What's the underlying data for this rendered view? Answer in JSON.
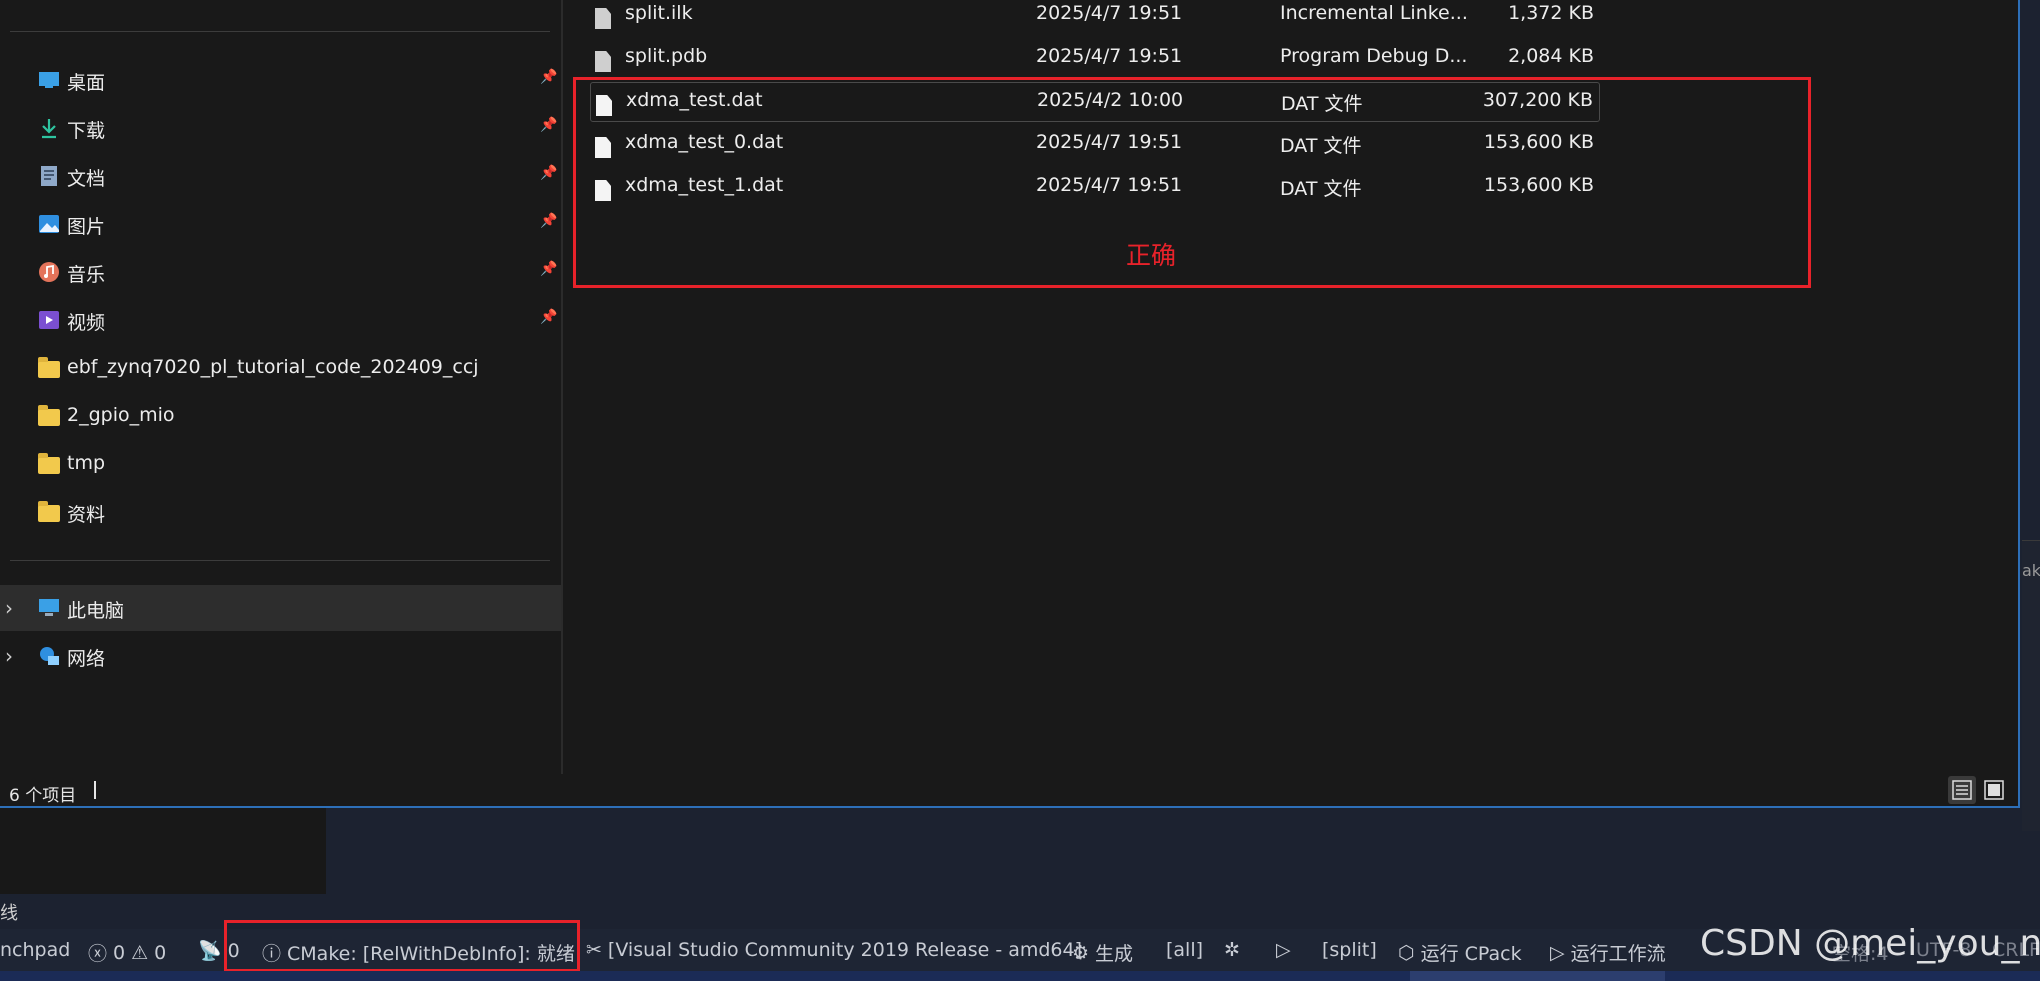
{
  "nav": {
    "quick_access": [
      {
        "label": "桌面",
        "icon": "desktop-icon"
      },
      {
        "label": "下载",
        "icon": "download-icon"
      },
      {
        "label": "文档",
        "icon": "document-icon"
      },
      {
        "label": "图片",
        "icon": "pictures-icon"
      },
      {
        "label": "音乐",
        "icon": "music-icon"
      },
      {
        "label": "视频",
        "icon": "video-icon"
      }
    ],
    "folders": [
      "ebf_zynq7020_pl_tutorial_code_202409_ccj",
      "2_gpio_mio",
      "tmp",
      "资料"
    ],
    "this_pc": "此电脑",
    "network": "网络"
  },
  "files": [
    {
      "name": "split.ilk",
      "date": "2025/4/7 19:51",
      "type": "Incremental Linke...",
      "size": "1,372 KB"
    },
    {
      "name": "split.pdb",
      "date": "2025/4/7 19:51",
      "type": "Program Debug D...",
      "size": "2,084 KB"
    },
    {
      "name": "xdma_test.dat",
      "date": "2025/4/2 10:00",
      "type": "DAT 文件",
      "size": "307,200 KB"
    },
    {
      "name": "xdma_test_0.dat",
      "date": "2025/4/7 19:51",
      "type": "DAT 文件",
      "size": "153,600 KB"
    },
    {
      "name": "xdma_test_1.dat",
      "date": "2025/4/7 19:51",
      "type": "DAT 文件",
      "size": "153,600 KB"
    }
  ],
  "annotation": "正确",
  "status": {
    "item_count": "6 个项目"
  },
  "side_fragment": "ak",
  "lower_label": "线",
  "vs_status": {
    "launchpad": "nchpad",
    "errors": "0",
    "warnings": "0",
    "broadcast": "0",
    "cmake": "CMake: [RelWithDebInfo]: 就绪",
    "kit": "[Visual Studio Community 2019 Release - amd64]",
    "build": "生成",
    "target_all": "[all]",
    "target_split": "[split]",
    "cpack": "运行 CPack",
    "workflow": "运行工作流",
    "tail_1": "空格:4",
    "tail_2": "UTF-8",
    "tail_3": "CRLF"
  },
  "watermark": "CSDN @mei_you_n",
  "colors": {
    "annotation_red": "#e8222a",
    "explorer_border": "#2d6fb8"
  }
}
